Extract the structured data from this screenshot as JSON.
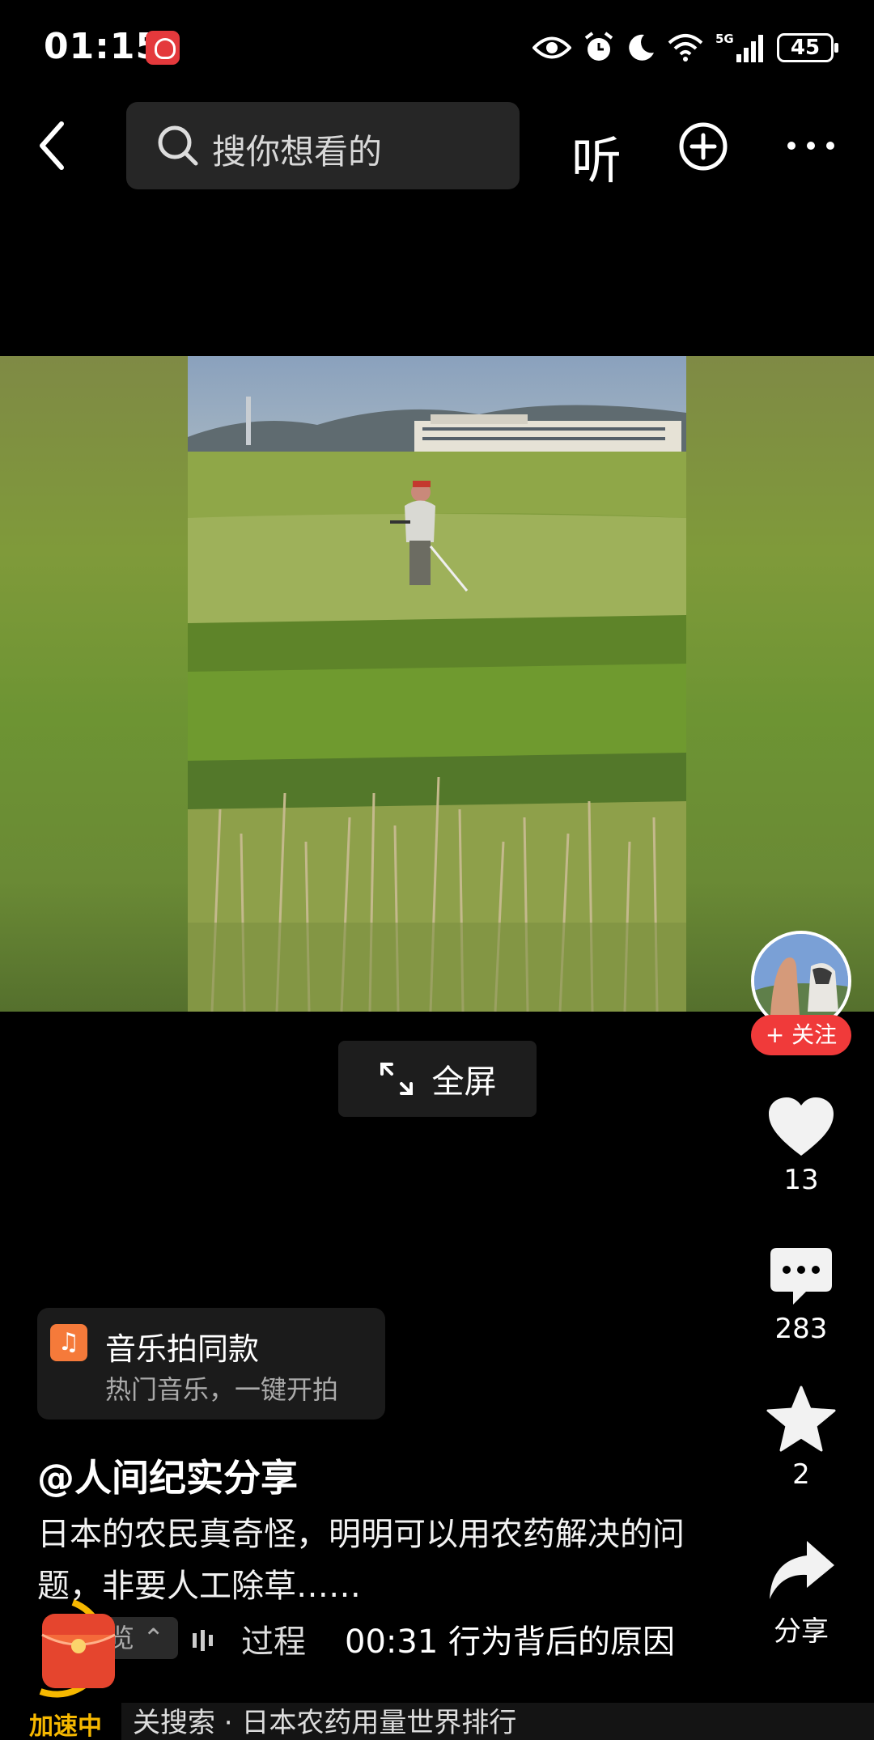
{
  "status_bar": {
    "time": "01:15",
    "network": "5G",
    "battery": "45"
  },
  "top_nav": {
    "search_placeholder": "搜你想看的",
    "listen_label": "听"
  },
  "video": {
    "fullscreen_label": "全屏"
  },
  "side_actions": {
    "follow_label": "+ 关注",
    "likes": "13",
    "comments": "283",
    "favorites": "2",
    "share_label": "分享"
  },
  "music_card": {
    "title": "音乐拍同款",
    "subtitle": "热门音乐，一键开拍"
  },
  "post": {
    "author": "@人间纪实分享",
    "description": "日本的农民真奇怪，明明可以用农药解决的问题，非要人工除草……"
  },
  "bottom": {
    "chip_label": "览",
    "segment_label": "过程",
    "segment_time": "00:31 行为背后的原因",
    "speed_label": "加速中",
    "related_search": "关搜索 · 日本农药用量世界排行"
  },
  "colors": {
    "accent_red": "#f03a3a",
    "music_orange": "#f57a3a",
    "speed_yellow": "#f6b800"
  }
}
